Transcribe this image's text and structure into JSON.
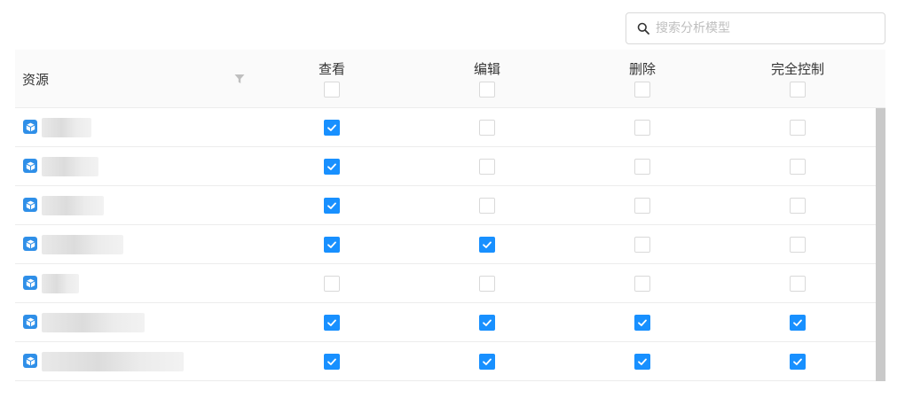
{
  "search": {
    "placeholder": "搜索分析模型"
  },
  "table": {
    "resource_header": "资源",
    "columns": [
      {
        "key": "view",
        "label": "查看",
        "all_checked": false
      },
      {
        "key": "edit",
        "label": "编辑",
        "all_checked": false
      },
      {
        "key": "delete",
        "label": "删除",
        "all_checked": false
      },
      {
        "key": "full",
        "label": "完全控制",
        "all_checked": false
      }
    ],
    "rows": [
      {
        "name": "",
        "permissions": [
          true,
          false,
          false,
          false
        ]
      },
      {
        "name": "",
        "permissions": [
          true,
          false,
          false,
          false
        ]
      },
      {
        "name": "",
        "permissions": [
          true,
          false,
          false,
          false
        ]
      },
      {
        "name": "",
        "permissions": [
          true,
          true,
          false,
          false
        ]
      },
      {
        "name": "",
        "permissions": [
          false,
          false,
          false,
          false
        ]
      },
      {
        "name": "",
        "permissions": [
          true,
          true,
          true,
          true
        ]
      },
      {
        "name": "",
        "permissions": [
          true,
          true,
          true,
          true
        ]
      }
    ]
  },
  "colors": {
    "checked": "#1890ff",
    "border": "#d9d9d9",
    "header_bg": "#fafafa",
    "icon": "#2f8fe8"
  },
  "icons": {
    "search": "search-icon",
    "filter": "filter-icon",
    "resource": "cube-icon",
    "check": "check-icon"
  }
}
